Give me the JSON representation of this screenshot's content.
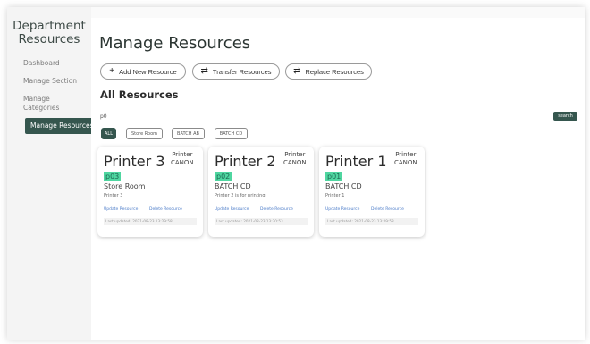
{
  "sidebar": {
    "brand_line1": "Department",
    "brand_line2": "Resources",
    "items": [
      {
        "label": "Dashboard"
      },
      {
        "label": "Manage Section"
      },
      {
        "label": "Manage"
      },
      {
        "label": "Categories"
      },
      {
        "label": "Manage Resources"
      }
    ]
  },
  "main": {
    "title": "Manage Resources",
    "actions": {
      "add_label": "Add New Resource",
      "transfer_label": "Transfer Resources",
      "replace_label": "Replace Resources"
    },
    "section_title": "All Resources",
    "search": {
      "value": "p0",
      "button_label": "search"
    },
    "filters": [
      "ALL",
      "Store Room",
      "BATCH AB",
      "BATCH CD"
    ],
    "cards": [
      {
        "name": "Printer 3",
        "type": "Printer",
        "brand": "CANON",
        "code": "p03",
        "location": "Store Room",
        "description": "Printer 3",
        "update_link": "Update Resource",
        "delete_link": "Delete Resource",
        "last_updated": "Last updated: 2021-08-23 13:29:58"
      },
      {
        "name": "Printer 2",
        "type": "Printer",
        "brand": "CANON",
        "code": "p02",
        "location": "BATCH CD",
        "description": "Printer 2 is for printing",
        "update_link": "Update Resource",
        "delete_link": "Delete Resource",
        "last_updated": "Last updated: 2021-08-23 13:30:53"
      },
      {
        "name": "Printer 1",
        "type": "Printer",
        "brand": "CANON",
        "code": "p01",
        "location": "BATCH CD",
        "description": "Printer 1",
        "update_link": "Update Resource",
        "delete_link": "Delete Resource",
        "last_updated": "Last updated: 2021-08-23 13:29:58"
      }
    ]
  },
  "colors": {
    "accent": "#35564e",
    "code_badge": "#4fd6a0",
    "link": "#4a7bc8"
  },
  "icons": {
    "add": "plus-icon",
    "transfer": "swap-icon",
    "replace": "swap-icon"
  }
}
